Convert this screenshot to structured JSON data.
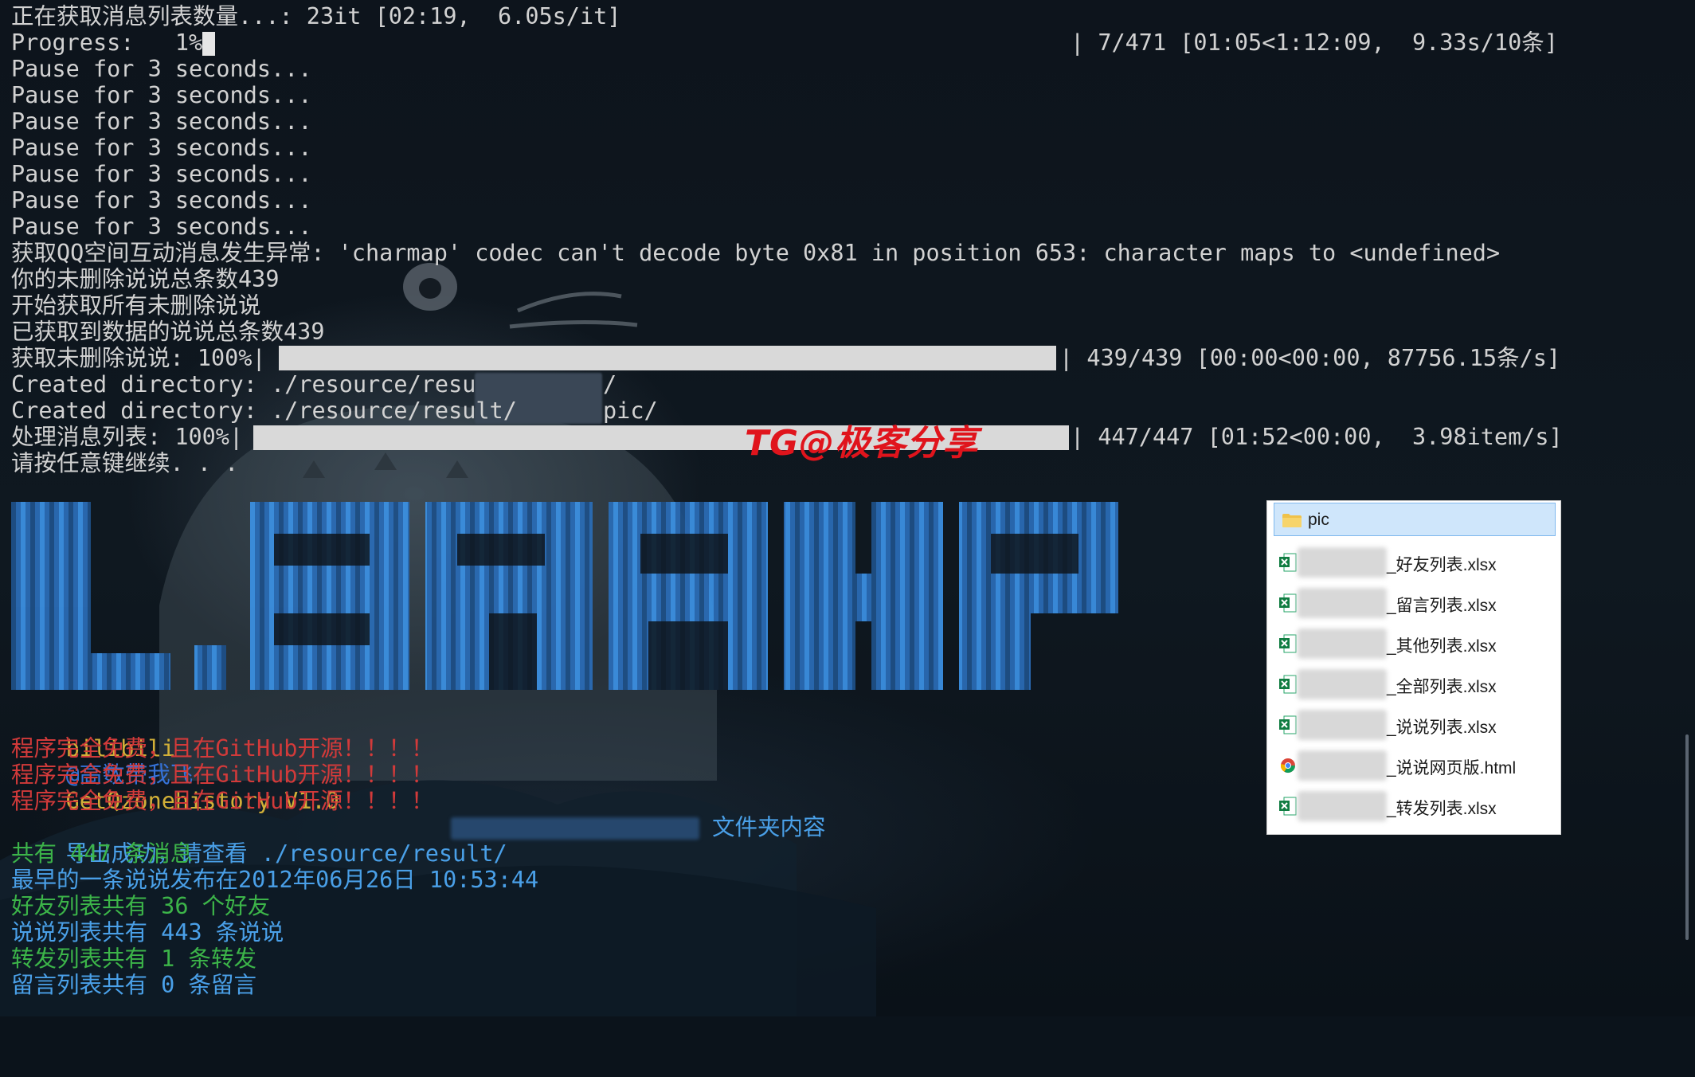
{
  "terminal": {
    "lines": [
      "正在获取消息列表数量...: 23it [02:19,  6.05s/it]",
      "Progress:   1%|",
      "Pause for 3 seconds...",
      "Pause for 3 seconds...",
      "Pause for 3 seconds...",
      "Pause for 3 seconds...",
      "Pause for 3 seconds...",
      "Pause for 3 seconds...",
      "Pause for 3 seconds...",
      "获取QQ空间互动消息发生异常: 'charmap' codec can't decode byte 0x81 in position 653: character maps to <undefined>",
      "你的未删除说说总条数439",
      "开始获取所有未删除说说",
      "已获取到数据的说说总条数439",
      "获取未删除说说: 100%|",
      "Created directory: ./resource/result/",
      "Created directory: ./resource/result/",
      "处理消息列表: 100%|",
      "请按任意键继续. . ."
    ],
    "progress_right": "| 7/471 [01:05<1:12:09,  9.33s/10条]",
    "progress_fraction": 0.01,
    "shuoshuo_bar_right": "| 439/439 [00:00<00:00, 87756.15条/s]",
    "shuoshuo_fraction": 1.0,
    "created_dir_1_suffix": "/",
    "created_dir_2_suffix": "pic/",
    "messages_bar_right": "| 447/447 [01:52<00:00,  3.98item/s]",
    "messages_fraction": 1.0
  },
  "watermark": "TG@极客分享",
  "banner": {
    "credit_prefix": "bilibili",
    "credit_author": "@高数带我飞",
    "credit_app": "GetQzonehistory V1.0",
    "free_notice": "程序完全免费，且在GitHub开源！！！！",
    "export_prefix": "导出成功，请查看 ./resource/result/",
    "export_suffix": "文件夹内容",
    "total_messages": "共有 447 条消息",
    "earliest_post": "最早的一条说说发布在2012年06月26日 10:53:44",
    "friends_count": "好友列表共有 36 个好友",
    "posts_count": "说说列表共有 443 条说说",
    "forwards_count": "转发列表共有 1 条转发",
    "comments_count": "留言列表共有 0 条留言"
  },
  "explorer": {
    "folder": "pic",
    "files": [
      {
        "name": "_好友列表.xlsx",
        "icon": "excel-icon"
      },
      {
        "name": "_留言列表.xlsx",
        "icon": "excel-icon"
      },
      {
        "name": "_其他列表.xlsx",
        "icon": "excel-icon"
      },
      {
        "name": "_全部列表.xlsx",
        "icon": "excel-icon"
      },
      {
        "name": "_说说列表.xlsx",
        "icon": "excel-icon"
      },
      {
        "name": "_说说网页版.html",
        "icon": "chrome-icon"
      },
      {
        "name": "_转发列表.xlsx",
        "icon": "excel-icon"
      }
    ]
  },
  "colors": {
    "terminal_text": "#d2d2d2",
    "yellow": "#d2b038",
    "blue": "#3572d8",
    "red": "#d23a3a",
    "cyan": "#4aa0e8",
    "green": "#3cb449",
    "watermark": "#e0141c",
    "banner_blue": "#3b8fe0"
  }
}
